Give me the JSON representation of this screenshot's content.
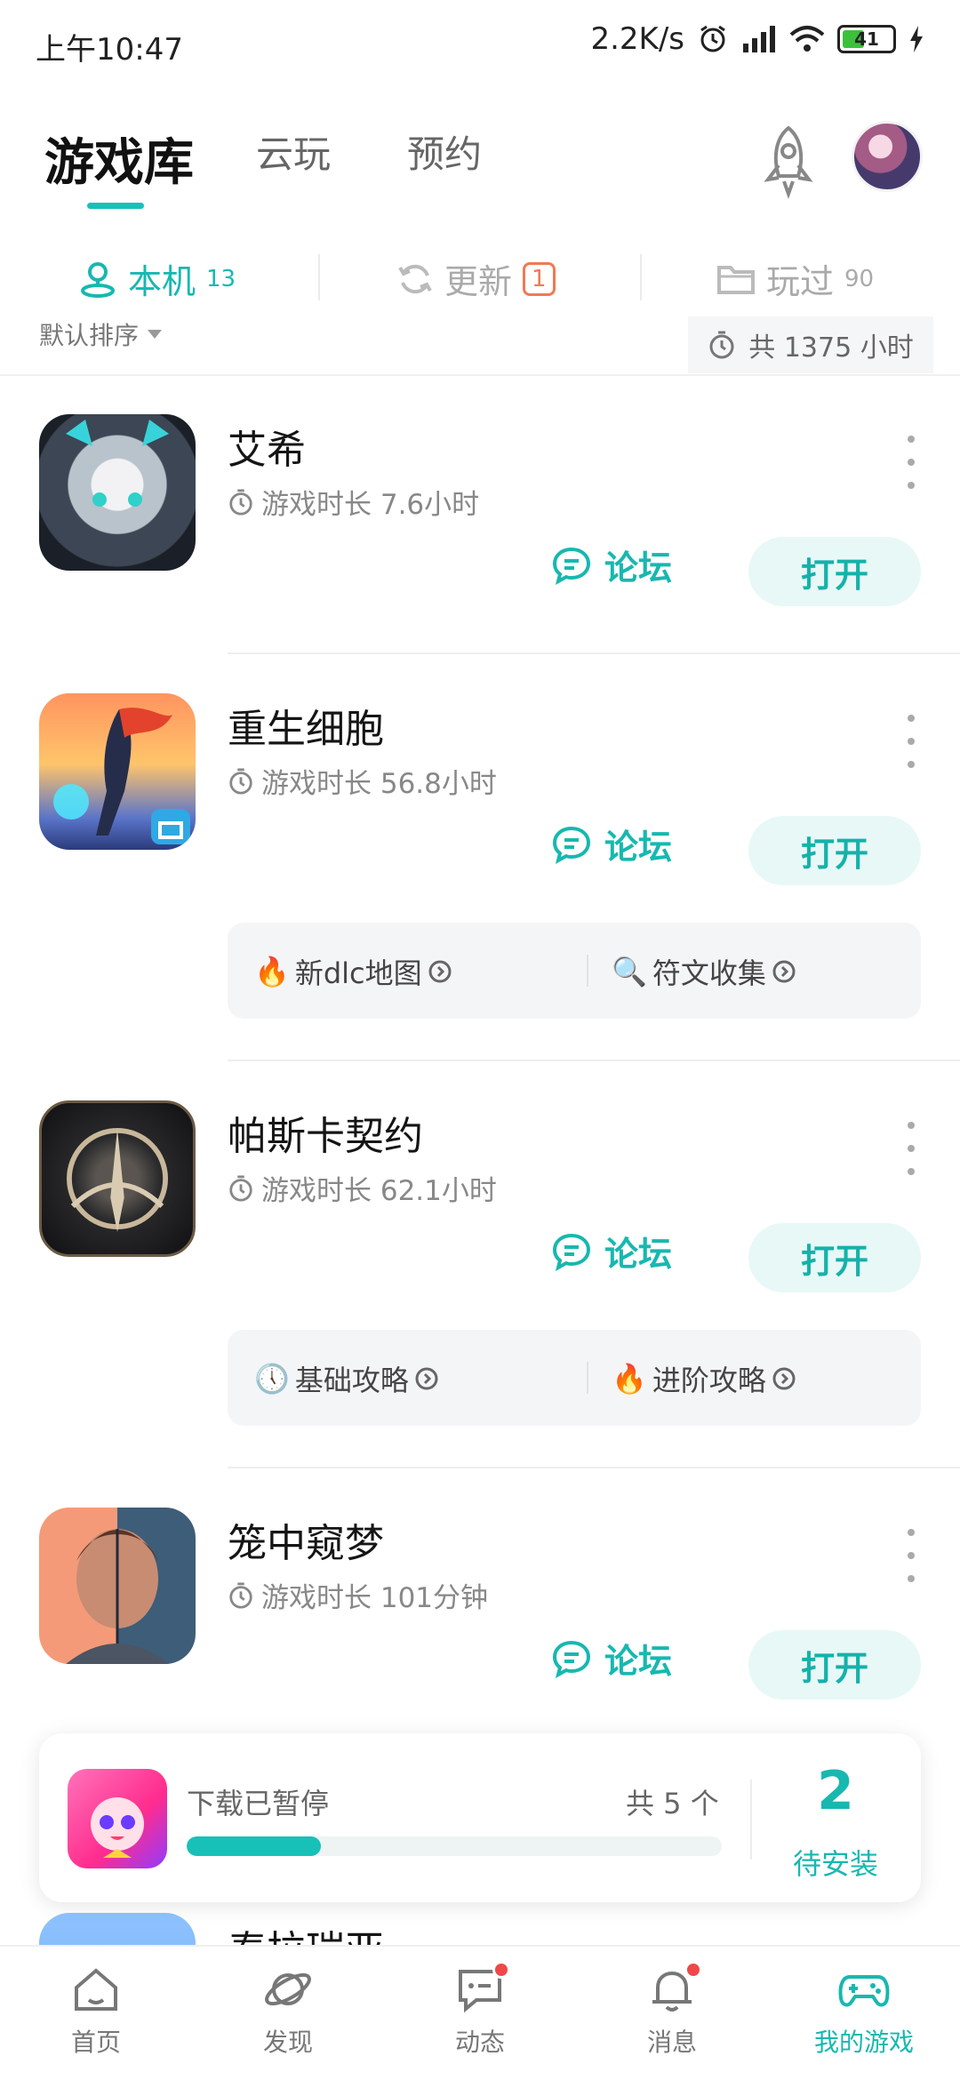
{
  "status_bar": {
    "time": "上午10:47",
    "net_speed": "2.2K/s",
    "battery": "41"
  },
  "top_tabs": [
    {
      "label": "游戏库",
      "active": true
    },
    {
      "label": "云玩",
      "active": false
    },
    {
      "label": "预约",
      "active": false
    }
  ],
  "sub_tabs": [
    {
      "label": "本机",
      "count": "13",
      "active": true
    },
    {
      "label": "更新",
      "badge": "1",
      "active": false
    },
    {
      "label": "玩过",
      "count": "90",
      "active": false
    }
  ],
  "sort": {
    "label": "默认排序"
  },
  "total_time": "共 1375 小时",
  "games": [
    {
      "title": "艾希",
      "playtime": "游戏时长 7.6小时",
      "forum_label": "论坛",
      "open_label": "打开",
      "tips": []
    },
    {
      "title": "重生细胞",
      "playtime": "游戏时长 56.8小时",
      "forum_label": "论坛",
      "open_label": "打开",
      "tips": [
        {
          "emoji": "🔥",
          "label": "新dlc地图"
        },
        {
          "emoji": "🔍",
          "label": "符文收集"
        }
      ]
    },
    {
      "title": "帕斯卡契约",
      "playtime": "游戏时长 62.1小时",
      "forum_label": "论坛",
      "open_label": "打开",
      "tips": [
        {
          "emoji": "🕔",
          "label": "基础攻略"
        },
        {
          "emoji": "🔥",
          "label": "进阶攻略"
        }
      ]
    },
    {
      "title": "笼中窥梦",
      "playtime": "游戏时长 101分钟",
      "forum_label": "论坛",
      "open_label": "打开",
      "tips": []
    },
    {
      "title": "泰拉瑞亚"
    }
  ],
  "download": {
    "status": "下载已暂停",
    "total": "共 5 个",
    "progress": 0.25,
    "pending_count": "2",
    "pending_label": "待安装"
  },
  "bottom_nav": [
    {
      "label": "首页",
      "icon": "home-icon",
      "active": false,
      "dot": false
    },
    {
      "label": "发现",
      "icon": "planet-icon",
      "active": false,
      "dot": false
    },
    {
      "label": "动态",
      "icon": "chat-icon",
      "active": false,
      "dot": true
    },
    {
      "label": "消息",
      "icon": "bell-icon",
      "active": false,
      "dot": true
    },
    {
      "label": "我的游戏",
      "icon": "gamepad-icon",
      "active": true,
      "dot": false
    }
  ],
  "colors": {
    "accent": "#17b8b0",
    "badge": "#ef7a54",
    "dot": "#f04848"
  }
}
